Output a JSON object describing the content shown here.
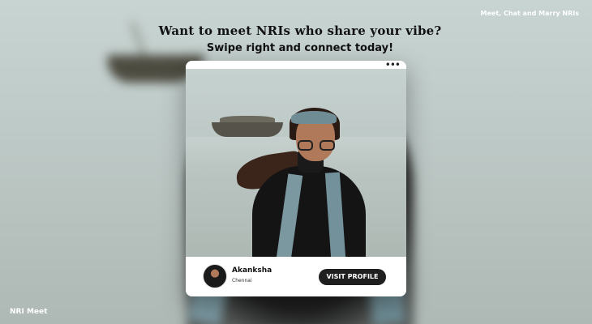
{
  "header": {
    "headline": "Want to meet NRIs who share your vibe?",
    "subheadline": "Swipe right and connect today!",
    "tagline": "Meet, Chat and Marry NRIs"
  },
  "brand": {
    "name": "NRI Meet"
  },
  "card": {
    "menu_icon": "more-horizontal-icon",
    "profile": {
      "name": "Akanksha",
      "city": "Chennai"
    },
    "visit_label": "VISIT PROFILE"
  },
  "colors": {
    "button_bg": "#1f1f1f",
    "button_text": "#ffffff",
    "card_bg": "#ffffff",
    "text_dark": "#111111"
  }
}
